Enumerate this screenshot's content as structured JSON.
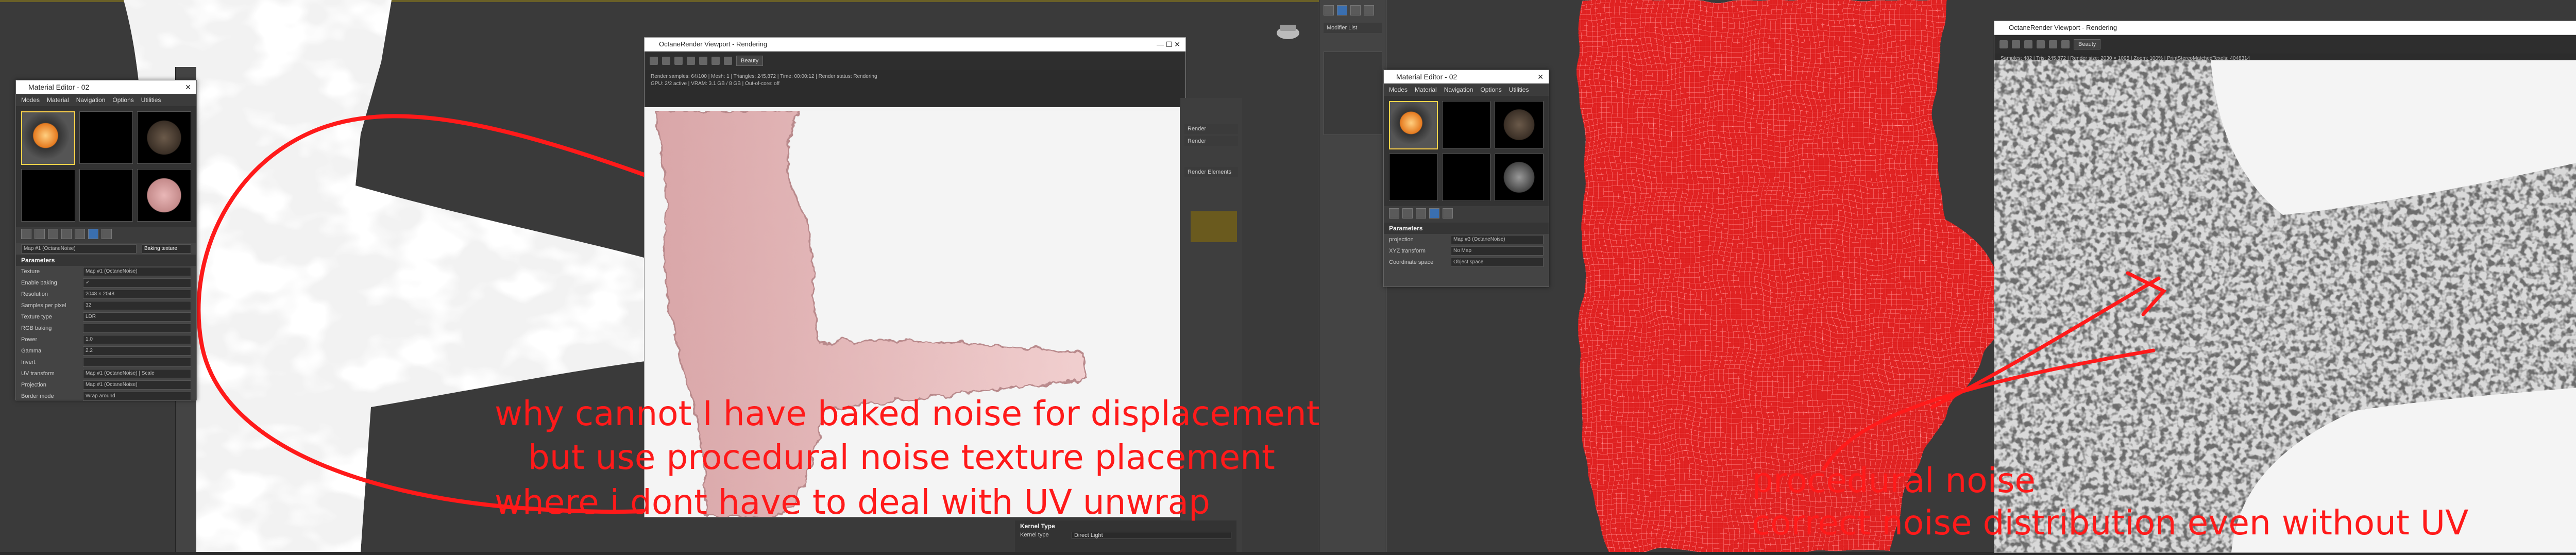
{
  "left_material_editor": {
    "title": "Material Editor - 02",
    "menu": [
      "Modes",
      "Material",
      "Navigation",
      "Options",
      "Utilities"
    ],
    "rollout_title": "Parameters",
    "rows": [
      {
        "label": "Texture",
        "value": "Map #1 (OctaneNoise)"
      },
      {
        "label": "Enable baking",
        "value": "✓"
      },
      {
        "label": "Resolution",
        "value": "2048 × 2048"
      },
      {
        "label": "Samples per pixel",
        "value": "32"
      },
      {
        "label": "Texture type",
        "value": "LDR"
      },
      {
        "label": "RGB baking",
        "value": ""
      },
      {
        "label": "Power",
        "value": "1.0"
      },
      {
        "label": "Gamma",
        "value": "2.2"
      },
      {
        "label": "Invert",
        "value": ""
      },
      {
        "label": "UV transform",
        "value": "Map #1 (OctaneNoise) | Scale"
      },
      {
        "label": "Projection",
        "value": "Map #1 (OctaneNoise)"
      },
      {
        "label": "Border mode",
        "value": "Wrap around"
      }
    ],
    "texture_field": "Map #1 (OctaneNoise)",
    "baking_button": "Baking texture"
  },
  "left_octane_viewport": {
    "title": "OctaneRender Viewport - Rendering",
    "scene_select": "Beauty",
    "status_text": "Render samples: 64/100 | Mesh: 1 | Triangles: 245,872 | Time: 00:00:12 | Render status: Rendering\nGPU: 2/2 active | VRAM: 3.1 GB / 8 GB | Out-of-core: off"
  },
  "left_render_setup": {
    "labels": [
      "Render",
      "Render",
      "Render Elements",
      "Kernel Type",
      "Kernel type",
      "Direct Light"
    ]
  },
  "right_material_editor": {
    "title": "Material Editor - 02",
    "menu": [
      "Modes",
      "Material",
      "Navigation",
      "Options",
      "Utilities"
    ],
    "rollout_title": "Parameters",
    "rows": [
      {
        "label": "projection",
        "value": "Map #3 (OctaneNoise)"
      },
      {
        "label": "XYZ transform",
        "value": "No Map"
      },
      {
        "label": "Coordinate space",
        "value": "Object space"
      }
    ]
  },
  "right_octane_viewport": {
    "title": "OctaneRender Viewport - Rendering",
    "scene_select": "Beauty",
    "status_text": "Samples: 482 | Tris: 245,872 | Render size: 2030 × 1095 | Zoom: 100% | PrintStereoMatchedTexels: 4048314"
  },
  "modifier_list": {
    "label": "Modifier List"
  },
  "annotations": {
    "left_lines": [
      "why cannot I have baked noise for displacement",
      "but use procedural noise texture placement",
      "where i dont have to deal with UV unwrap"
    ],
    "right_lines": [
      "procedural noise",
      "correct noise distribution even without UV"
    ]
  },
  "colors": {
    "annotation": "#ff1a1a",
    "red_mesh": "#e02020",
    "viewport_bg": "#3a3a3a"
  }
}
